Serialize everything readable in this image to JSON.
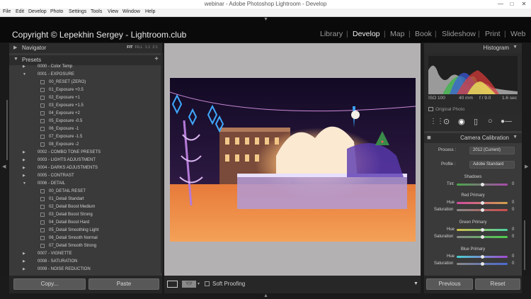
{
  "window": {
    "title": "webinar - Adobe Photoshop Lightroom - Develop",
    "minimize": "—",
    "maximize": "□",
    "close": "✕"
  },
  "menu": [
    "File",
    "Edit",
    "Develop",
    "Photo",
    "Settings",
    "Tools",
    "View",
    "Window",
    "Help"
  ],
  "identity_plate": "Copyright © Lepekhin Sergey - Lightroom.club",
  "modules": [
    "Library",
    "Develop",
    "Map",
    "Book",
    "Slideshow",
    "Print",
    "Web"
  ],
  "module_separator": "|",
  "active_module": "Develop",
  "navigator": {
    "title": "Navigator",
    "modes": [
      "FIT",
      "FILL",
      "1:1",
      "2:1"
    ]
  },
  "presets": {
    "title": "Presets",
    "add": "+",
    "rows": [
      {
        "label": "0000 - Color Temp",
        "level": 0,
        "open": false
      },
      {
        "label": "0001 - EXPOSURE",
        "level": 0,
        "open": true
      },
      {
        "label": "00_RESET (ZERO)",
        "level": 1
      },
      {
        "label": "01_Exposure +0.5",
        "level": 1
      },
      {
        "label": "02_Exposure +1",
        "level": 1
      },
      {
        "label": "03_Exposure +1.5",
        "level": 1
      },
      {
        "label": "04_Exposure +2",
        "level": 1
      },
      {
        "label": "05_Exposure -0.5",
        "level": 1
      },
      {
        "label": "06_Exposure -1",
        "level": 1
      },
      {
        "label": "07_Exposure -1.5",
        "level": 1
      },
      {
        "label": "08_Exposure -2",
        "level": 1
      },
      {
        "label": "0002 - COMBO TONE PRESETS",
        "level": 0,
        "open": false
      },
      {
        "label": "0003 - LIGHTS ADJUSTMENT",
        "level": 0,
        "open": false
      },
      {
        "label": "0004 - DARKS ADJUSTMENTS",
        "level": 0,
        "open": false
      },
      {
        "label": "0005 - CONTRAST",
        "level": 0,
        "open": false
      },
      {
        "label": "0006 - DETAIL",
        "level": 0,
        "open": true
      },
      {
        "label": "00_DETAIL RESET",
        "level": 1
      },
      {
        "label": "01_Detail Standart",
        "level": 1
      },
      {
        "label": "02_Detail Boost Medium",
        "level": 1
      },
      {
        "label": "03_Detail Boost Strong",
        "level": 1
      },
      {
        "label": "04_Detail Boost Hard",
        "level": 1
      },
      {
        "label": "05_Detail Smoothing Light",
        "level": 1
      },
      {
        "label": "06_Detail Smooth Normal",
        "level": 1
      },
      {
        "label": "07_Detail Smooth Strong",
        "level": 1
      },
      {
        "label": "0007 - VIGNETTE",
        "level": 0,
        "open": false
      },
      {
        "label": "0008 - SATURATION",
        "level": 0,
        "open": false
      },
      {
        "label": "0009 - NOISE REDUCTION",
        "level": 0,
        "open": false
      }
    ]
  },
  "left_buttons": {
    "copy": "Copy...",
    "paste": "Paste"
  },
  "toolbar": {
    "soft_proofing": "Soft Proofing",
    "yy": "Y|Y"
  },
  "histogram": {
    "title": "Histogram",
    "iso": "ISO 100",
    "focal": "40 mm",
    "aperture": "f / 9.0",
    "shutter": "1.6 sec",
    "original_photo": "Original Photo"
  },
  "calibration": {
    "title": "Camera Calibration",
    "process_label": "Process :",
    "process_value": "2012 (Current)",
    "profile_label": "Profile :",
    "profile_value": "Adobe Standard",
    "shadows": {
      "title": "Shadows",
      "tint_label": "Tint",
      "tint": 0
    },
    "red": {
      "title": "Red Primary",
      "hue": 0,
      "saturation": 0
    },
    "green": {
      "title": "Green Primary",
      "hue": 0,
      "saturation": 0
    },
    "blue": {
      "title": "Blue Primary",
      "hue": 0,
      "saturation": 0
    },
    "hue_label": "Hue",
    "saturation_label": "Saturation"
  },
  "right_buttons": {
    "previous": "Previous",
    "reset": "Reset"
  },
  "colors": {
    "panel": "#3a3a3a",
    "background": "#1b1b1b",
    "canvas": "#b4b1b3",
    "accent": "#ffffff"
  }
}
